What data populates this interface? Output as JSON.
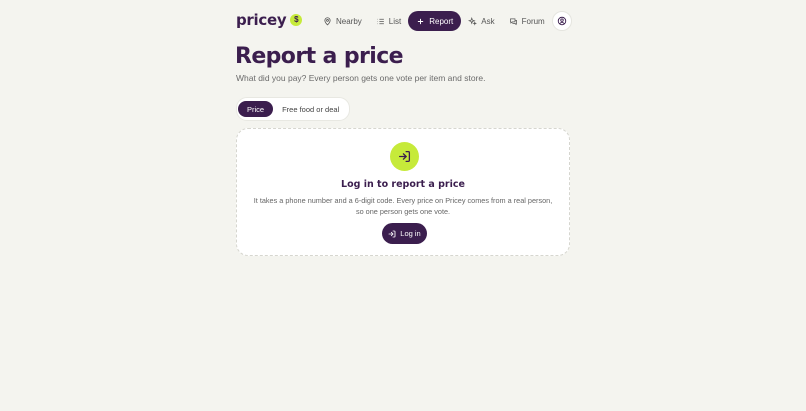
{
  "logo": {
    "text": "pricey",
    "badge": "$"
  },
  "nav": {
    "items": [
      {
        "label": "Nearby",
        "icon": "map-pin-icon"
      },
      {
        "label": "List",
        "icon": "list-icon"
      },
      {
        "label": "Report",
        "icon": "plus-icon"
      },
      {
        "label": "Ask",
        "icon": "sparkles-icon"
      },
      {
        "label": "Forum",
        "icon": "chat-icon"
      }
    ],
    "active": "Report",
    "profile_icon": "user-circle-icon"
  },
  "page": {
    "title": "Report a price",
    "subtitle": "What did you pay? Every person gets one vote per item and store."
  },
  "tabs": [
    {
      "label": "Price",
      "active": true
    },
    {
      "label": "Free food or deal",
      "active": false
    }
  ],
  "login_card": {
    "icon": "log-in-icon",
    "title": "Log in to report a price",
    "text_line1": "It takes a phone number and a 6-digit code. Every price on Pricey comes from a real person,",
    "text_line2": "so one person gets one vote.",
    "button_label": "Log in"
  },
  "colors": {
    "brand": "#3b1e4e",
    "accent": "#c6ea3a",
    "background": "#f4f4ef"
  }
}
